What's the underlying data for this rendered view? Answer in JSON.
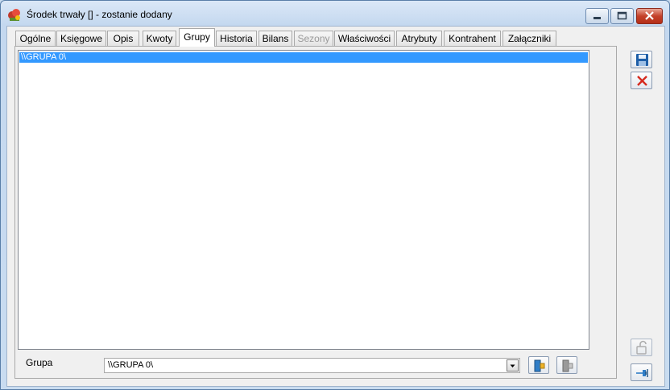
{
  "window": {
    "title": "Środek trwały [] - zostanie dodany"
  },
  "tabs": [
    {
      "label": "Ogólne",
      "state": "normal"
    },
    {
      "label": "Księgowe",
      "state": "normal"
    },
    {
      "label": "Opis",
      "state": "normal"
    },
    {
      "label": "Kwoty",
      "state": "normal"
    },
    {
      "label": "Grupy",
      "state": "active"
    },
    {
      "label": "Historia",
      "state": "normal"
    },
    {
      "label": "Bilans",
      "state": "normal"
    },
    {
      "label": "Sezony",
      "state": "disabled"
    },
    {
      "label": "Właściwości",
      "state": "normal"
    },
    {
      "label": "Atrybuty",
      "state": "normal"
    },
    {
      "label": "Kontrahent",
      "state": "normal"
    },
    {
      "label": "Załączniki",
      "state": "normal"
    }
  ],
  "groups_list": {
    "items": [
      "\\\\GRUPA 0\\"
    ],
    "selected": 0
  },
  "grupa": {
    "label": "Grupa",
    "value": "\\\\GRUPA 0\\"
  },
  "icons": {
    "app": "fixed-asset-icon",
    "save": "save-icon",
    "cancel": "cancel-icon",
    "lock": "padlock-icon",
    "pin": "pin-icon",
    "go_to_group": "go-to-group-icon",
    "go_to_group_disabled": "go-to-group-disabled-icon"
  },
  "colors": {
    "selection": "#3399ff",
    "close_button": "#c4412a",
    "save_icon": "#1f5fa8",
    "cancel_icon": "#d62a1e"
  }
}
